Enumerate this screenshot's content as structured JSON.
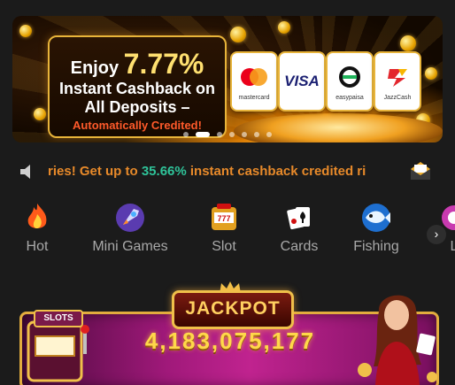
{
  "banner": {
    "line1_prefix": "Enjoy",
    "line1_percent": "7.77%",
    "line2": "Instant Cashback on",
    "line3": "All Deposits –",
    "line4": "Automatically Credited!",
    "payment_methods": [
      {
        "name": "mastercard",
        "caption": "mastercard",
        "icon": "mastercard-logo"
      },
      {
        "name": "VISA",
        "caption": "",
        "icon": "visa-logo"
      },
      {
        "name": "easypaisa",
        "caption": "easypaisa",
        "icon": "easypaisa-logo"
      },
      {
        "name": "JazzCash",
        "caption": "JazzCash",
        "icon": "jazzcash-logo"
      }
    ],
    "carousel_pages": 7,
    "carousel_active_index": 1
  },
  "marquee": {
    "text_before": "ries! Get up to ",
    "highlight": "35.66%",
    "text_after": " instant cashback credited ri",
    "left_icon": "speaker-icon",
    "right_icon": "mail-icon"
  },
  "categories": [
    {
      "label": "Hot",
      "icon": "flame-icon"
    },
    {
      "label": "Mini Games",
      "icon": "rocket-icon"
    },
    {
      "label": "Slot",
      "icon": "slot-machine-icon"
    },
    {
      "label": "Cards",
      "icon": "cards-icon"
    },
    {
      "label": "Fishing",
      "icon": "fish-icon"
    },
    {
      "label": "L",
      "icon": "lottery-icon"
    }
  ],
  "next_arrow": "›",
  "jackpot": {
    "title": "JACKPOT",
    "amount": "4,183,075,177",
    "slots_sign": "SLOTS"
  },
  "colors": {
    "page_bg": "#1b1b1b",
    "marquee_text": "#e88a2a",
    "marquee_highlight": "#2fc49a",
    "category_label": "#a8a8a8",
    "jackpot_gold": "#ffd84a"
  }
}
